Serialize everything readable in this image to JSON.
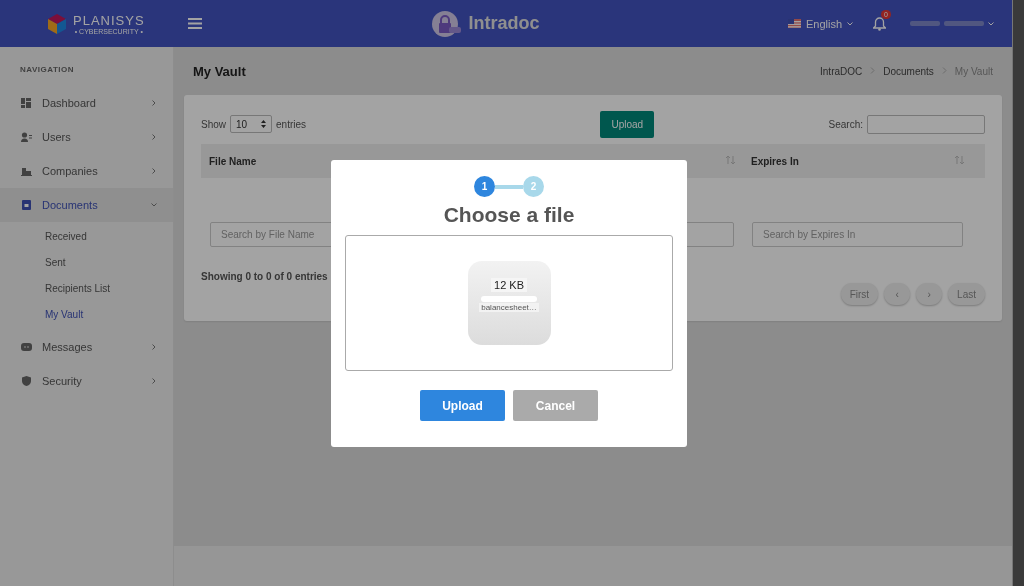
{
  "header": {
    "brand": "PLANISYS",
    "tagline": "• CYBERSECURITY •",
    "app_name": "Intradoc",
    "language": "English",
    "notification_count": "0"
  },
  "sidebar": {
    "heading": "NAVIGATION",
    "items": [
      {
        "label": "Dashboard",
        "selected": false,
        "expanded": false
      },
      {
        "label": "Users",
        "selected": false,
        "expanded": false
      },
      {
        "label": "Companies",
        "selected": false,
        "expanded": false
      },
      {
        "label": "Documents",
        "selected": true,
        "expanded": true,
        "children": [
          {
            "label": "Received",
            "selected": false
          },
          {
            "label": "Sent",
            "selected": false
          },
          {
            "label": "Recipients List",
            "selected": false
          },
          {
            "label": "My Vault",
            "selected": true
          }
        ]
      },
      {
        "label": "Messages",
        "selected": false,
        "expanded": false
      },
      {
        "label": "Security",
        "selected": false,
        "expanded": false
      }
    ]
  },
  "page": {
    "title": "My Vault",
    "breadcrumbs": [
      {
        "label": "IntraDOC",
        "current": false
      },
      {
        "label": "Documents",
        "current": false
      },
      {
        "label": "My Vault",
        "current": true
      }
    ]
  },
  "table": {
    "show_label": "Show",
    "page_length": "10",
    "entries_label": "entries",
    "upload_button": "Upload",
    "search_label": "Search:",
    "columns": [
      {
        "label": "File Name"
      },
      {
        "label": "Expires In"
      }
    ],
    "filters": [
      {
        "placeholder": "Search by File Name"
      },
      {
        "placeholder": "Search by Expires In"
      }
    ],
    "info": "Showing 0 to 0 of 0 entries",
    "pagination": [
      "First",
      "‹",
      "›",
      "Last"
    ]
  },
  "modal": {
    "steps": [
      {
        "label": "1",
        "active": true
      },
      {
        "label": "2",
        "active": false
      }
    ],
    "title": "Choose a file",
    "file": {
      "size": "12 KB",
      "name": "balancesheet…"
    },
    "buttons": [
      {
        "label": "Upload",
        "kind": "primary"
      },
      {
        "label": "Cancel",
        "kind": "secondary"
      }
    ]
  }
}
